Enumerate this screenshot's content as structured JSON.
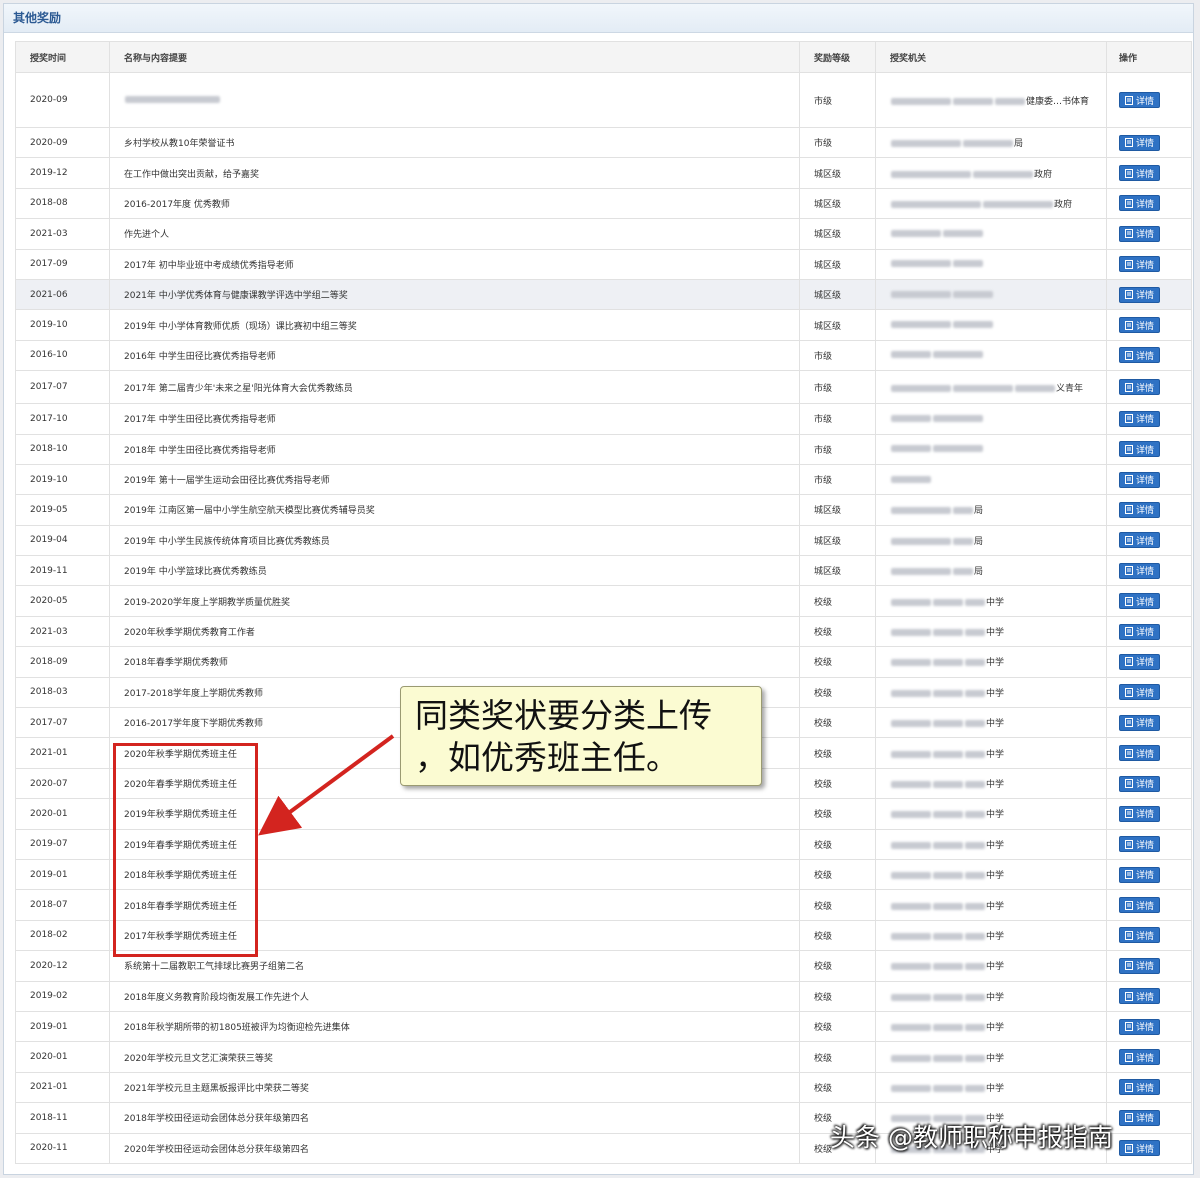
{
  "panel": {
    "title": "其他奖励"
  },
  "table": {
    "headers": {
      "time": "授奖时间",
      "name": "名称与内容提要",
      "level": "奖励等级",
      "org": "授奖机关",
      "op": "操作"
    },
    "detail_label": "详情",
    "rows": [
      {
        "time": "2020-09",
        "name": "",
        "level": "市级",
        "org": "健康委…书体育"
      },
      {
        "time": "2020-09",
        "name": "乡村学校从教10年荣誉证书",
        "level": "市级",
        "org": "局"
      },
      {
        "time": "2019-12",
        "name": "在工作中做出突出贡献，给予嘉奖",
        "level": "城区级",
        "org": "政府"
      },
      {
        "time": "2018-08",
        "name": "2016-2017年度 优秀教师",
        "level": "城区级",
        "org": "政府"
      },
      {
        "time": "2021-03",
        "name": "作先进个人",
        "level": "城区级",
        "org": ""
      },
      {
        "time": "2017-09",
        "name": "2017年 初中毕业班中考成绩优秀指导老师",
        "level": "城区级",
        "org": ""
      },
      {
        "time": "2021-06",
        "name": "2021年 中小学优秀体育与健康课教学评选中学组二等奖",
        "level": "城区级",
        "org": ""
      },
      {
        "time": "2019-10",
        "name": "2019年 中小学体育教师优质（现场）课比赛初中组三等奖",
        "level": "城区级",
        "org": ""
      },
      {
        "time": "2016-10",
        "name": "2016年 中学生田径比赛优秀指导老师",
        "level": "市级",
        "org": ""
      },
      {
        "time": "2017-07",
        "name": "2017年 第二届青少年'未来之星'阳光体育大会优秀教练员",
        "level": "市级",
        "org": "义青年"
      },
      {
        "time": "2017-10",
        "name": "2017年 中学生田径比赛优秀指导老师",
        "level": "市级",
        "org": ""
      },
      {
        "time": "2018-10",
        "name": "2018年 中学生田径比赛优秀指导老师",
        "level": "市级",
        "org": ""
      },
      {
        "time": "2019-10",
        "name": "2019年 第十一届学生运动会田径比赛优秀指导老师",
        "level": "市级",
        "org": ""
      },
      {
        "time": "2019-05",
        "name": "2019年 江南区第一届中小学生航空航天模型比赛优秀辅导员奖",
        "level": "城区级",
        "org": "局"
      },
      {
        "time": "2019-04",
        "name": "2019年 中小学生民族传统体育项目比赛优秀教练员",
        "level": "城区级",
        "org": "局"
      },
      {
        "time": "2019-11",
        "name": "2019年 中小学篮球比赛优秀教练员",
        "level": "城区级",
        "org": "局"
      },
      {
        "time": "2020-05",
        "name": "2019-2020学年度上学期教学质量优胜奖",
        "level": "校级",
        "org": "中学"
      },
      {
        "time": "2021-03",
        "name": "2020年秋季学期优秀教育工作者",
        "level": "校级",
        "org": "中学"
      },
      {
        "time": "2018-09",
        "name": "2018年春季学期优秀教师",
        "level": "校级",
        "org": "中学"
      },
      {
        "time": "2018-03",
        "name": "2017-2018学年度上学期优秀教师",
        "level": "校级",
        "org": "中学"
      },
      {
        "time": "2017-07",
        "name": "2016-2017学年度下学期优秀教师",
        "level": "校级",
        "org": "中学"
      },
      {
        "time": "2021-01",
        "name": "2020年秋季学期优秀班主任",
        "level": "校级",
        "org": "中学"
      },
      {
        "time": "2020-07",
        "name": "2020年春季学期优秀班主任",
        "level": "校级",
        "org": "中学"
      },
      {
        "time": "2020-01",
        "name": "2019年秋季学期优秀班主任",
        "level": "校级",
        "org": "中学"
      },
      {
        "time": "2019-07",
        "name": "2019年春季学期优秀班主任",
        "level": "校级",
        "org": "中学"
      },
      {
        "time": "2019-01",
        "name": "2018年秋季学期优秀班主任",
        "level": "校级",
        "org": "中学"
      },
      {
        "time": "2018-07",
        "name": "2018年春季学期优秀班主任",
        "level": "校级",
        "org": "中学"
      },
      {
        "time": "2018-02",
        "name": "2017年秋季学期优秀班主任",
        "level": "校级",
        "org": "中学"
      },
      {
        "time": "2020-12",
        "name": "系统第十二届教职工气排球比赛男子组第二名",
        "level": "校级",
        "org": "中学"
      },
      {
        "time": "2019-02",
        "name": "2018年度义务教育阶段均衡发展工作先进个人",
        "level": "校级",
        "org": "中学"
      },
      {
        "time": "2019-01",
        "name": "2018年秋学期所带的初1805班被评为均衡迎检先进集体",
        "level": "校级",
        "org": "中学"
      },
      {
        "time": "2020-01",
        "name": "2020年学校元旦文艺汇演荣获三等奖",
        "level": "校级",
        "org": "中学"
      },
      {
        "time": "2021-01",
        "name": "2021年学校元旦主题黑板报评比中荣获二等奖",
        "level": "校级",
        "org": "中学"
      },
      {
        "time": "2018-11",
        "name": "2018年学校田径运动会团体总分获年级第四名",
        "level": "校级",
        "org": "中学"
      },
      {
        "time": "2020-11",
        "name": "2020年学校田径运动会团体总分获年级第四名",
        "level": "校级",
        "org": "中学"
      }
    ]
  },
  "annotation": {
    "callout_line1": "同类奖状要分类上传",
    "callout_line2": "，如优秀班主任。"
  },
  "watermark": "头条 @教师职称申报指南",
  "colors": {
    "highlight_box": "#d3241f",
    "button": "#2f72c4",
    "callout_bg": "#fbfbd2"
  }
}
